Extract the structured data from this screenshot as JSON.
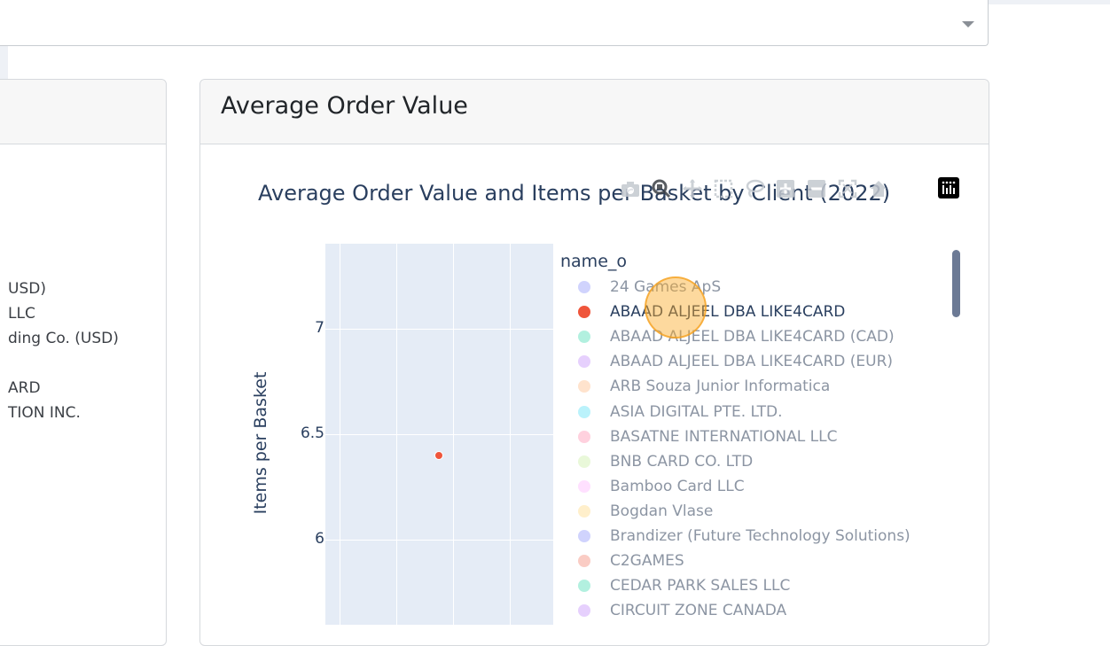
{
  "left_card": {
    "legend_items": [
      "USD)",
      "LLC",
      "ding Co. (USD)",
      "",
      "ARD",
      "TION INC."
    ]
  },
  "card": {
    "title": "Average Order Value"
  },
  "chart_data": {
    "type": "scatter",
    "title": "Average Order Value and Items per Basket by Client (2022)",
    "xlabel": "",
    "ylabel": "Items per Basket",
    "y_ticks": [
      "7",
      "6.5",
      "6"
    ],
    "ylim": [
      5.6,
      7.4
    ],
    "points": [
      {
        "series": "ABAAD ALJEEL DBA LIKE4CARD",
        "y": 6.4
      }
    ],
    "legend_title": "name_o",
    "legend_placement": "right",
    "series": [
      {
        "name": "24 Games ApS",
        "color": "#636efa",
        "active": false
      },
      {
        "name": "ABAAD ALJEEL DBA LIKE4CARD",
        "color": "#ef553b",
        "active": true
      },
      {
        "name": "ABAAD ALJEEL DBA LIKE4CARD (CAD)",
        "color": "#00cc96",
        "active": false
      },
      {
        "name": "ABAAD ALJEEL DBA LIKE4CARD (EUR)",
        "color": "#ab63fa",
        "active": false
      },
      {
        "name": "ARB Souza Junior Informatica",
        "color": "#ffa15a",
        "active": false
      },
      {
        "name": "ASIA DIGITAL PTE. LTD.",
        "color": "#19d3f3",
        "active": false
      },
      {
        "name": "BASATNE INTERNATIONAL LLC",
        "color": "#ff6692",
        "active": false
      },
      {
        "name": "BNB CARD CO. LTD",
        "color": "#b6e880",
        "active": false
      },
      {
        "name": "Bamboo Card LLC",
        "color": "#ff97ff",
        "active": false
      },
      {
        "name": "Bogdan Vlase",
        "color": "#fecb52",
        "active": false
      },
      {
        "name": "Brandizer (Future Technology Solutions)",
        "color": "#636efa",
        "active": false
      },
      {
        "name": "C2GAMES",
        "color": "#ef553b",
        "active": false
      },
      {
        "name": "CEDAR PARK SALES LLC",
        "color": "#00cc96",
        "active": false
      },
      {
        "name": "CIRCUIT ZONE CANADA",
        "color": "#ab63fa",
        "active": false
      }
    ]
  },
  "modebar": {
    "icons": [
      "camera-icon",
      "zoom-icon",
      "pan-icon",
      "box-select-icon",
      "lasso-icon",
      "zoom-in-icon",
      "zoom-out-icon",
      "autoscale-icon",
      "reset-axes-icon",
      "plotly-logo-icon"
    ]
  }
}
